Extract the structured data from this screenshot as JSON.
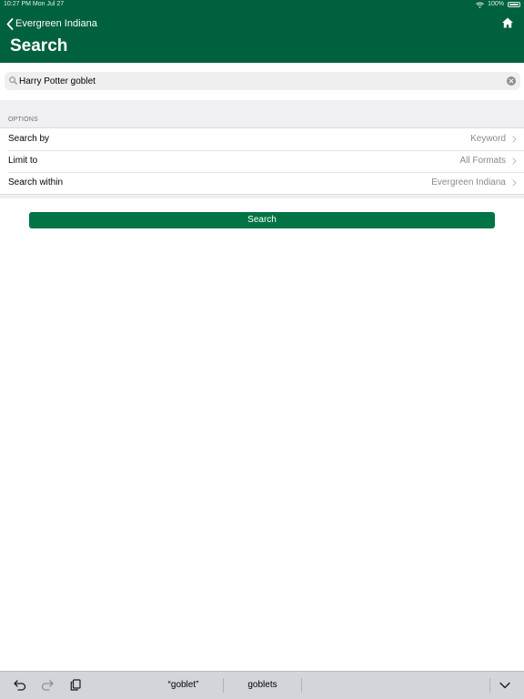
{
  "status_bar": {
    "time_date": "10:27 PM   Mon Jul 27",
    "battery": "100%"
  },
  "nav": {
    "back_label": "Evergreen Indiana",
    "title": "Search"
  },
  "search": {
    "value": "Harry Potter goblet",
    "placeholder": ""
  },
  "options": {
    "header": "OPTIONS",
    "rows": [
      {
        "label": "Search by",
        "value": "Keyword"
      },
      {
        "label": "Limit to",
        "value": "All Formats"
      },
      {
        "label": "Search within",
        "value": "Evergreen Indiana"
      }
    ]
  },
  "search_button": "Search",
  "keyboard_bar": {
    "suggestion_1": "“goblet”",
    "suggestion_2": "goblets"
  },
  "colors": {
    "header": "#00613e",
    "button": "#007445",
    "grouped_bg": "#efeff4"
  }
}
